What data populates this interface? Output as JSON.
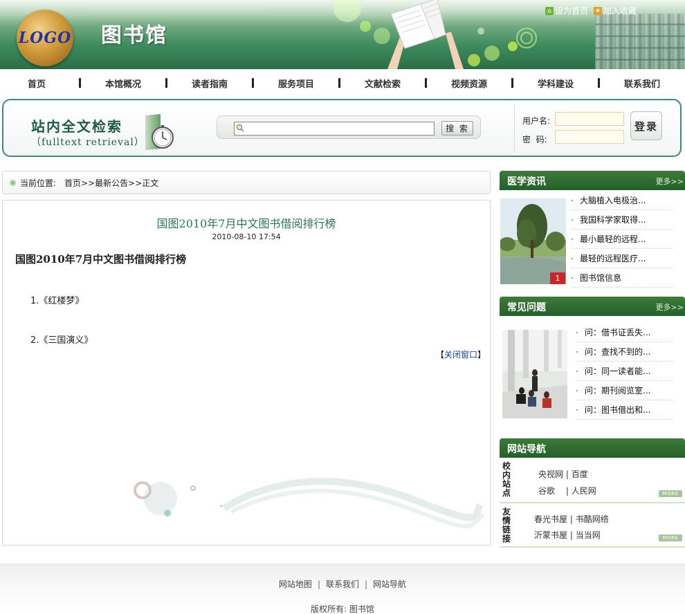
{
  "header": {
    "logo_text": "LOGO",
    "site_title": "图书馆",
    "top_links": [
      "设为首页",
      "加入收藏"
    ]
  },
  "nav": {
    "items": [
      "首页",
      "本馆概况",
      "读者指南",
      "服务项目",
      "文献检索",
      "视频资源",
      "学科建设",
      "联系我们"
    ]
  },
  "search": {
    "title": "站内全文检索",
    "subtitle": "（fulltext retrieval）",
    "input_value": "",
    "button_label": "搜 索",
    "login": {
      "username_label": "用户名:",
      "password_label": "密  码:",
      "username_value": "",
      "password_value": "",
      "button_label": "登录"
    }
  },
  "breadcrumb": {
    "label": "当前位置:",
    "path": "首页>>最新公告>>正文"
  },
  "article": {
    "title": "国图2010年7月中文图书借阅排行榜",
    "date": "2010-08-10 17:54",
    "heading": "国图2010年7月中文图书借阅排行榜",
    "items": [
      "1.《红楼梦》",
      "2.《三国演义》"
    ],
    "close_open": "【",
    "close_label": "关闭窗口",
    "close_close": "】"
  },
  "medical_news": {
    "title": "医学资讯",
    "more": "更多>>",
    "photo_index": "1",
    "items": [
      "大脑植入电极治...",
      "我国科学家取得...",
      "最小最轻的远程...",
      "最轻的远程医疗...",
      "图书馆信息"
    ]
  },
  "faq": {
    "title": "常见问题",
    "more": "更多>>",
    "items": [
      "问：借书证丢失...",
      "问：查找不到的...",
      "问：同一读者能...",
      "问：期刊阅览室...",
      "问：图书借出和..."
    ]
  },
  "site_nav": {
    "title": "网站导航",
    "sections": [
      {
        "label": "校内站点",
        "rows": [
          [
            "央视网",
            "百度"
          ],
          [
            "谷歌",
            "人民网"
          ]
        ],
        "more": "MORE"
      },
      {
        "label": "友情链接",
        "rows": [
          [
            "春光书屋",
            "书酷网络"
          ],
          [
            "沂蒙书屋",
            "当当网"
          ]
        ],
        "more": "MORE"
      }
    ]
  },
  "footer": {
    "links": [
      "网站地图",
      "联系我们",
      "网站导航"
    ],
    "copyright": "版权所有: 图书馆"
  },
  "colors": {
    "brand_green": "#2a6e48",
    "panel_green": "#24602a",
    "title_teal": "#2d7263",
    "link_blue": "#14458f",
    "accent_red": "#c8282a"
  }
}
